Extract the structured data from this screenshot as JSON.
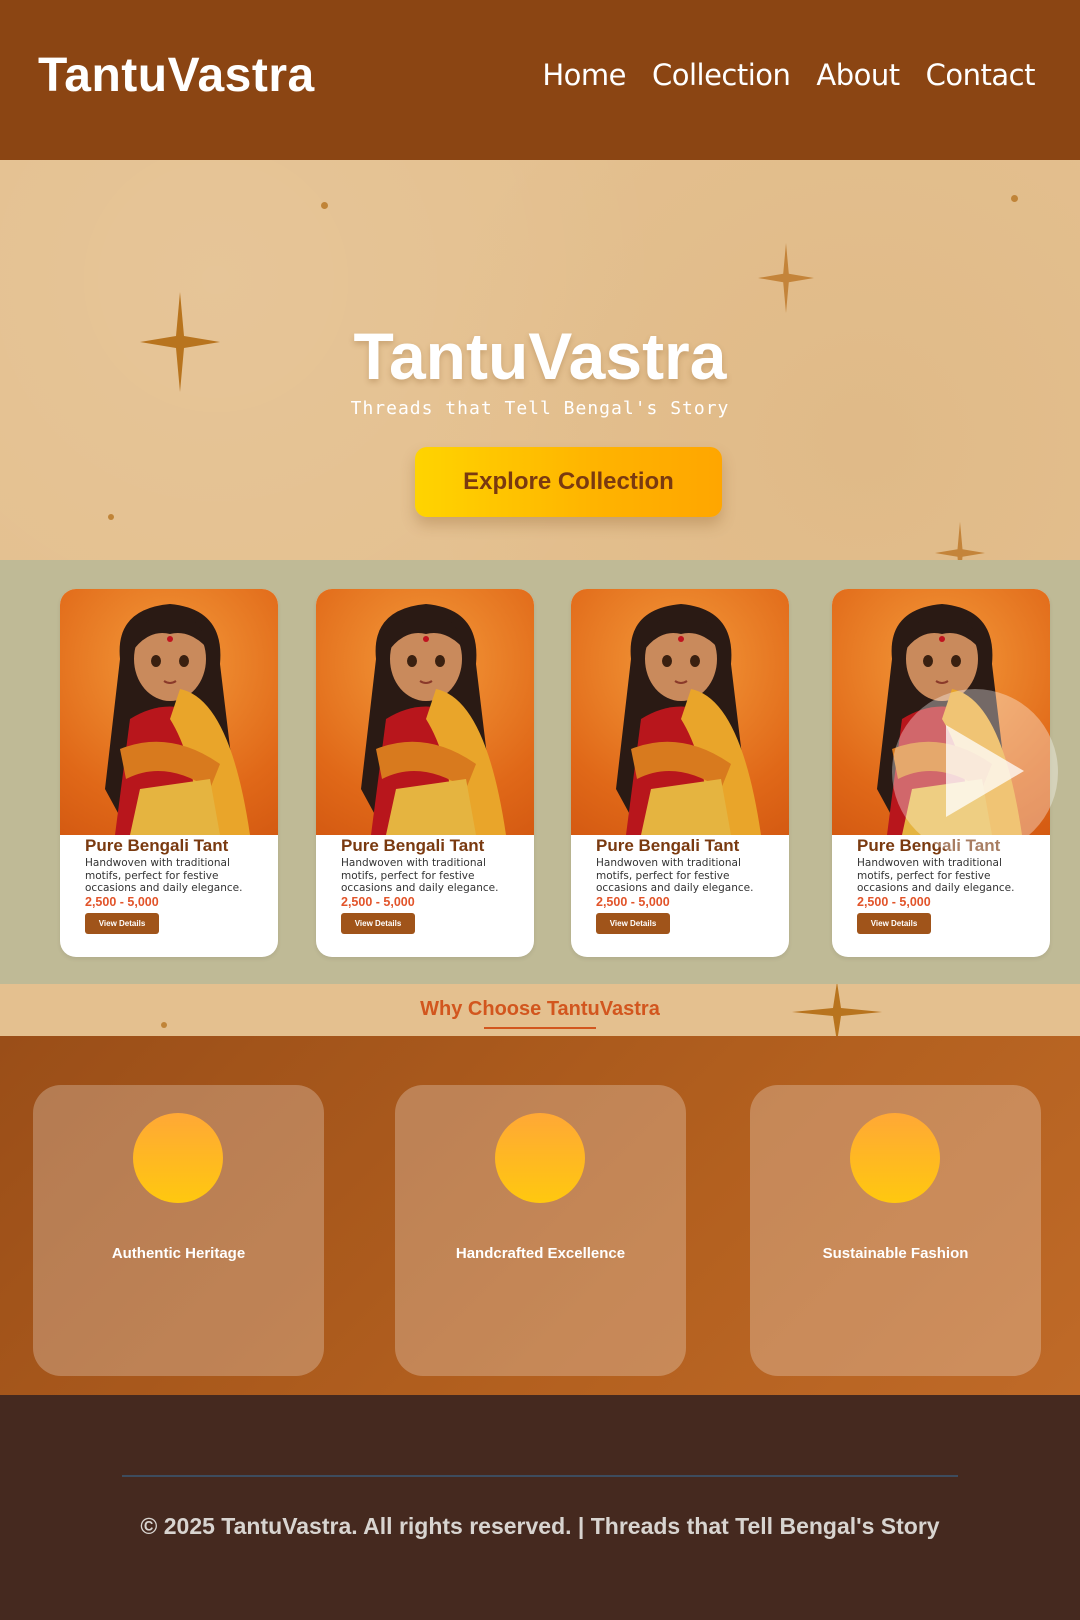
{
  "header": {
    "logo": "TantuVastra",
    "nav": [
      "Home",
      "Collection",
      "About",
      "Contact"
    ]
  },
  "hero": {
    "title": "TantuVastra",
    "tagline": "Threads that Tell Bengal's Story",
    "cta": "Explore Collection"
  },
  "products": [
    {
      "title": "Pure Bengali Tant",
      "description": "Handwoven with traditional motifs, perfect for festive occasions and daily elegance.",
      "price": "2,500 - 5,000",
      "button": "View Details"
    },
    {
      "title": "Pure Bengali Tant",
      "description": "Handwoven with traditional motifs, perfect for festive occasions and daily elegance.",
      "price": "2,500 - 5,000",
      "button": "View Details"
    },
    {
      "title": "Pure Bengali Tant",
      "description": "Handwoven with traditional motifs, perfect for festive occasions and daily elegance.",
      "price": "2,500 - 5,000",
      "button": "View Details"
    },
    {
      "title": "Pure Bengali Tant",
      "description": "Handwoven with traditional motifs, perfect for festive occasions and daily elegance.",
      "price": "2,500 - 5,000",
      "button": "View Details"
    }
  ],
  "why": {
    "title": "Why Choose TantuVastra"
  },
  "features": [
    {
      "label": "Authentic Heritage"
    },
    {
      "label": "Handcrafted Excellence"
    },
    {
      "label": "Sustainable Fashion"
    }
  ],
  "footer": {
    "text": "© 2025 TantuVastra. All rights reserved. | Threads that Tell Bengal's Story"
  },
  "colors": {
    "header_bg": "#8b4513",
    "hero_bg": "#e4c08f",
    "cta_gold": "#ffc107",
    "accent": "#d2561e",
    "footer_bg": "#45291f"
  },
  "icons": [
    "sparkle-icon",
    "play-icon"
  ]
}
